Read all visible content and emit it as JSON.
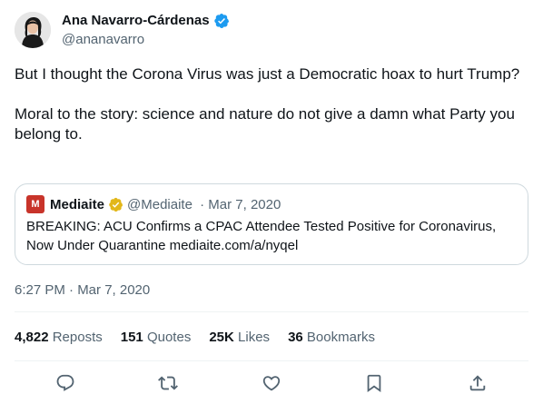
{
  "author": {
    "name": "Ana Navarro-Cárdenas",
    "handle": "@ananavarro",
    "verified": true,
    "badge_color": "#1d9bf0",
    "avatar_icon": "profile-photo"
  },
  "tweet": {
    "paragraphs": [
      "But I thought the Corona Virus was just a Democratic hoax to hurt Trump?",
      "Moral to the story: science and nature do not give a damn what Party you belong to."
    ],
    "timestamp": "6:27 PM · Mar 7, 2020"
  },
  "quote": {
    "logo_letter": "M",
    "logo_color": "#c8342a",
    "name": "Mediaite",
    "badge_color": "#e2b719",
    "handle": "@Mediaite",
    "date": " · Mar 7, 2020",
    "text": "BREAKING: ACU Confirms a CPAC Attendee Tested Positive for Coronavirus, Now Under Quarantine mediaite.com/a/nyqel"
  },
  "stats": [
    {
      "value": "4,822",
      "label": "Reposts"
    },
    {
      "value": "151",
      "label": "Quotes"
    },
    {
      "value": "25K",
      "label": "Likes"
    },
    {
      "value": "36",
      "label": "Bookmarks"
    }
  ],
  "actions": [
    "reply-icon",
    "repost-icon",
    "like-icon",
    "bookmark-icon",
    "share-icon"
  ]
}
